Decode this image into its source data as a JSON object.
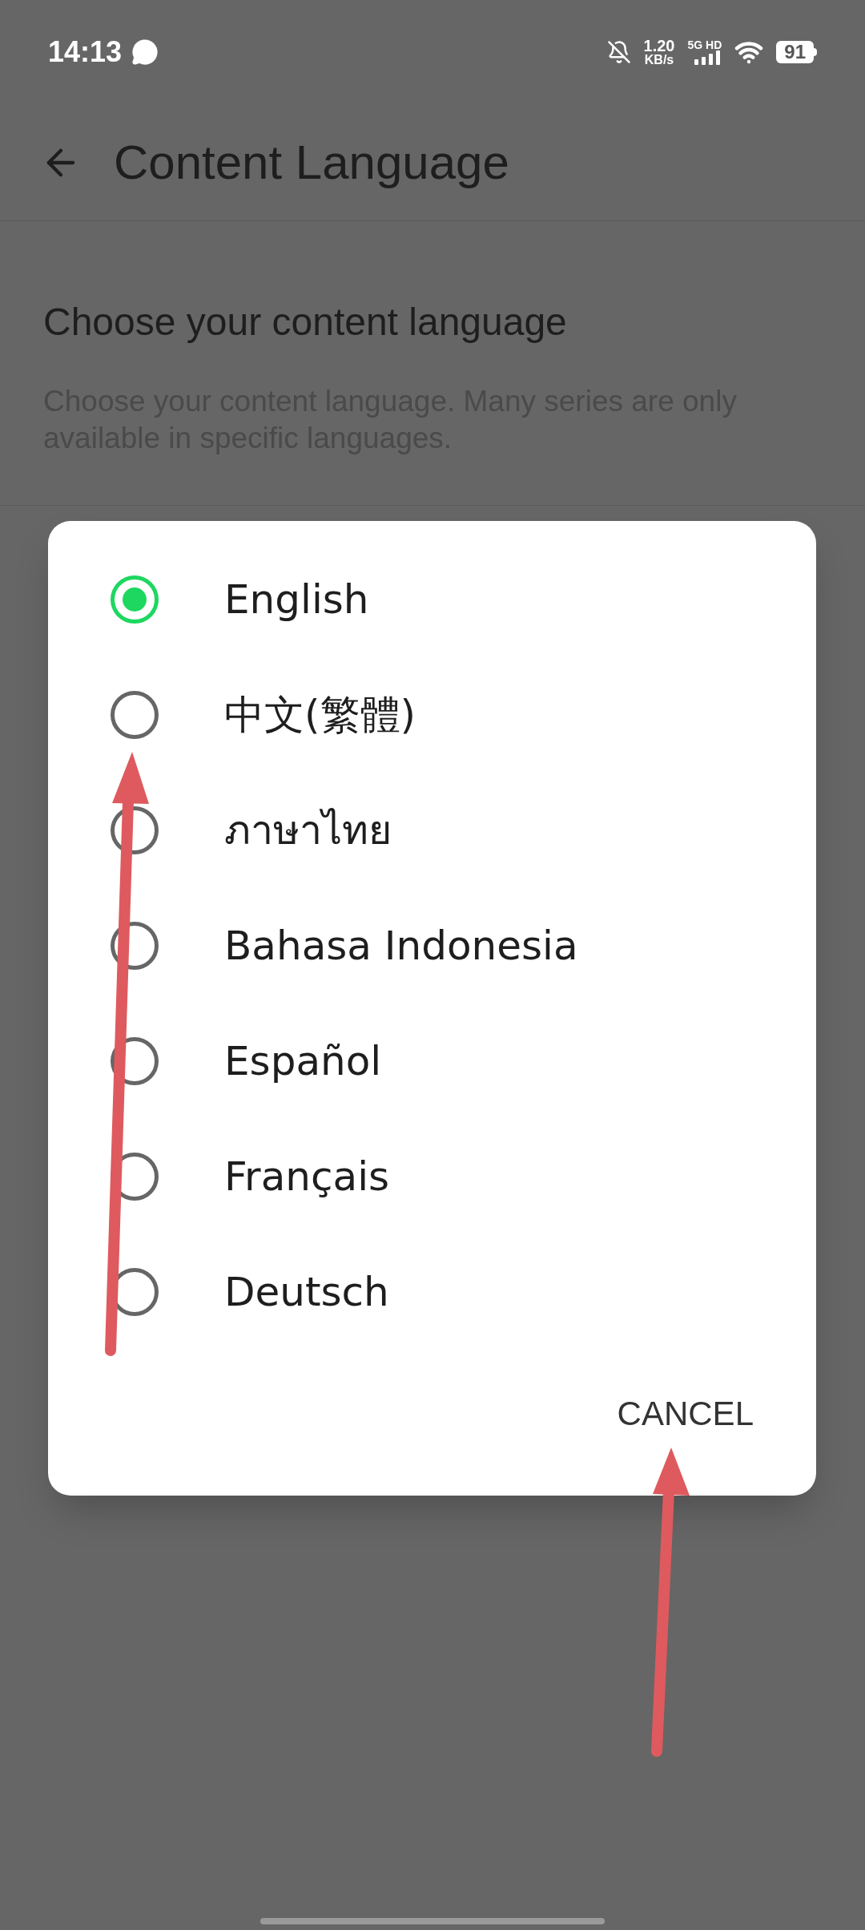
{
  "status_bar": {
    "time": "14:13",
    "speed_value": "1.20",
    "speed_unit": "KB/s",
    "network": "5G HD",
    "battery": "91"
  },
  "header": {
    "title": "Content Language"
  },
  "section": {
    "title": "Choose your content language",
    "description": "Choose your content language. Many series are only available in specific languages."
  },
  "dialog": {
    "options": [
      {
        "label": "English",
        "selected": true
      },
      {
        "label": "中文(繁體)",
        "selected": false
      },
      {
        "label": "ภาษาไทย",
        "selected": false
      },
      {
        "label": "Bahasa Indonesia",
        "selected": false
      },
      {
        "label": "Español",
        "selected": false
      },
      {
        "label": "Français",
        "selected": false
      },
      {
        "label": "Deutsch",
        "selected": false
      }
    ],
    "cancel": "CANCEL"
  }
}
